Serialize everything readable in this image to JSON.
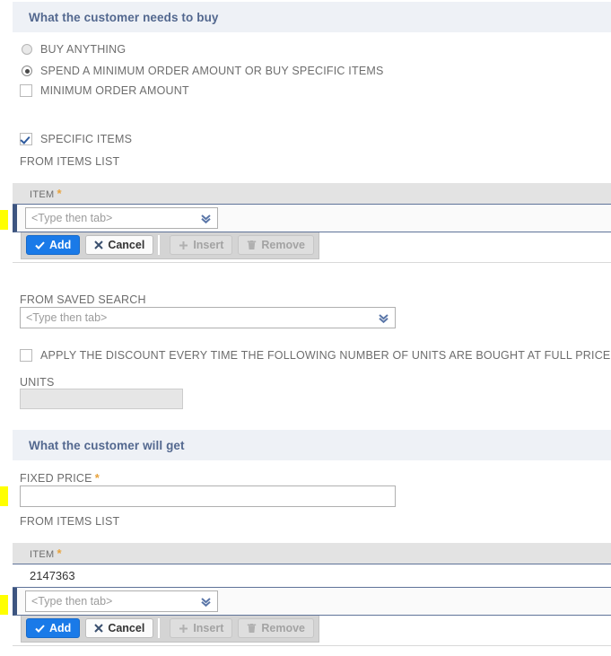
{
  "sections": {
    "buy": {
      "title": "What the customer needs to buy",
      "radios": [
        {
          "label": "BUY ANYTHING",
          "selected": false
        },
        {
          "label": "SPEND A MINIMUM ORDER AMOUNT OR BUY SPECIFIC ITEMS",
          "selected": true
        }
      ],
      "minimum_order_amount": {
        "label": "MINIMUM ORDER AMOUNT",
        "checked": false
      },
      "specific_items": {
        "label": "SPECIFIC ITEMS",
        "checked": true
      },
      "from_items_list_label": "FROM ITEMS LIST",
      "from_saved_search_label": "FROM SAVED SEARCH",
      "from_saved_search_value": "<Type then tab>",
      "apply_discount": {
        "label": "APPLY THE DISCOUNT EVERY TIME THE FOLLOWING NUMBER OF UNITS ARE BOUGHT AT FULL PRICE",
        "checked": false
      },
      "units_label": "UNITS",
      "units_value": "",
      "table": {
        "column_header": "ITEM",
        "required_marker": "*",
        "rows": [],
        "editor_placeholder": "<Type then tab>"
      }
    },
    "get": {
      "title": "What the customer will get",
      "fixed_price_label": "FIXED PRICE",
      "fixed_price_required_marker": "*",
      "fixed_price_value": "",
      "from_items_list_label": "FROM ITEMS LIST",
      "table": {
        "column_header": "ITEM",
        "required_marker": "*",
        "rows": [
          "2147363"
        ],
        "editor_placeholder": "<Type then tab>"
      }
    }
  },
  "buttons": {
    "add": "Add",
    "cancel": "Cancel",
    "insert": "Insert",
    "remove": "Remove",
    "add_icon": "check-icon",
    "cancel_icon": "x-icon",
    "insert_icon": "plus-icon",
    "remove_icon": "trash-icon"
  },
  "icons": {
    "dropdown_chevron": "double-chevron-down-icon"
  },
  "colors": {
    "section_band": "#eef1f6",
    "section_title": "#53688f",
    "primary_button": "#1a7ae8",
    "required_star": "#e8a33d",
    "row_active_border": "#3d5580",
    "marker_yellow": "#ffff00",
    "table_header": "#e3e3e3"
  }
}
